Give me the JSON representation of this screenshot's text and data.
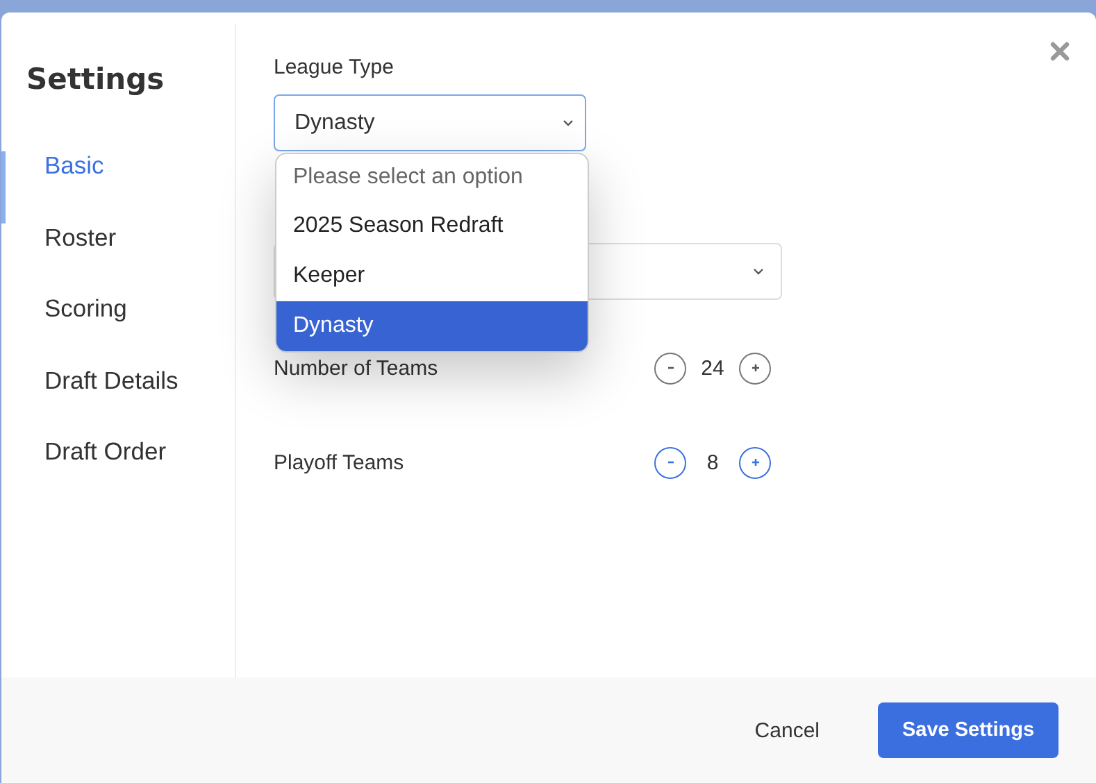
{
  "modal": {
    "title": "Settings"
  },
  "sidebar": {
    "items": [
      {
        "label": "Basic",
        "selected": true
      },
      {
        "label": "Roster",
        "selected": false
      },
      {
        "label": "Scoring",
        "selected": false
      },
      {
        "label": "Draft Details",
        "selected": false
      },
      {
        "label": "Draft Order",
        "selected": false
      }
    ]
  },
  "league_type": {
    "label": "League Type",
    "value": "Dynasty",
    "expanded": true,
    "options": [
      {
        "label": "Please select an option",
        "kind": "placeholder",
        "selected": false
      },
      {
        "label": "2025 Season Redraft",
        "kind": "option",
        "selected": false
      },
      {
        "label": "Keeper",
        "kind": "option",
        "selected": false
      },
      {
        "label": "Dynasty",
        "kind": "option",
        "selected": true
      }
    ]
  },
  "steppers": [
    {
      "label": "Number of Teams",
      "value": "24",
      "disabled": true
    },
    {
      "label": "Playoff Teams",
      "value": "8",
      "disabled": false
    }
  ],
  "footer": {
    "cancel": "Cancel",
    "save": "Save Settings"
  }
}
